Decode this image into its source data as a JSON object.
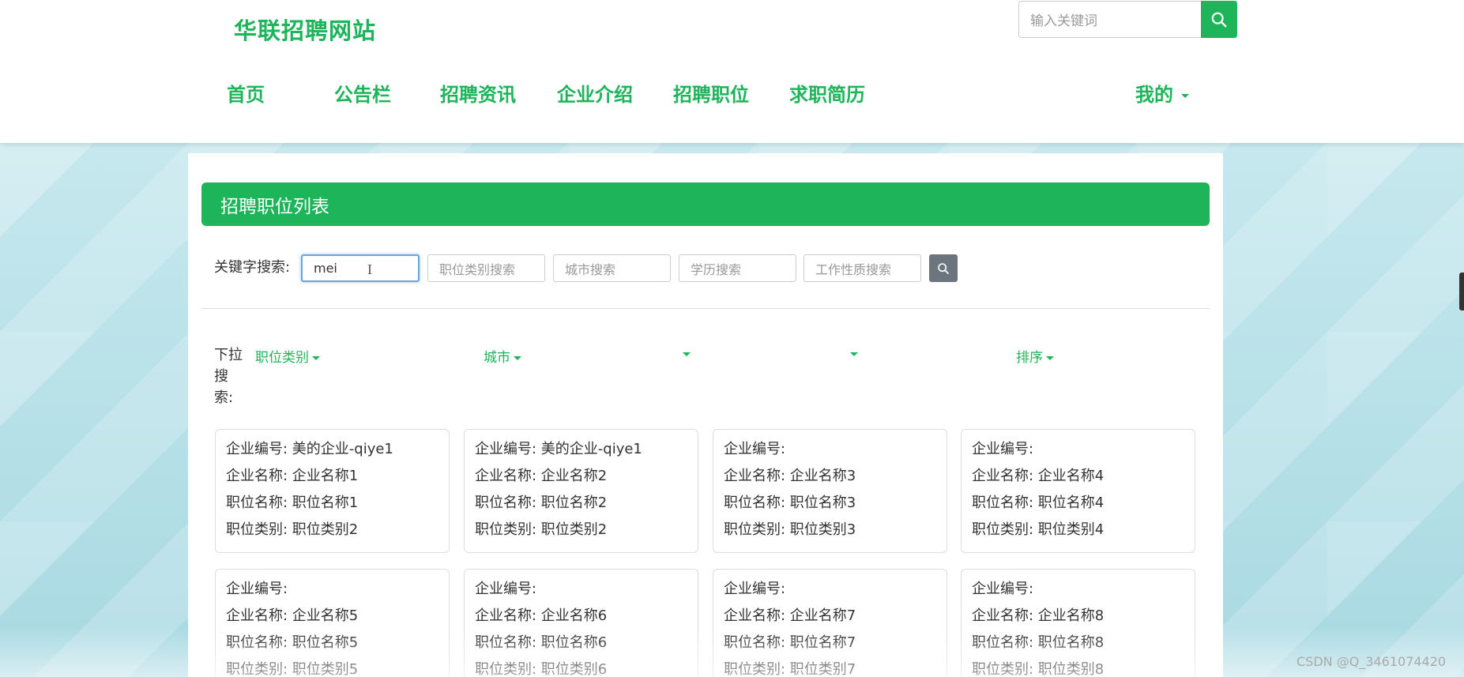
{
  "header": {
    "site_title": "华联招聘网站",
    "search_placeholder": "输入关键词",
    "nav": [
      {
        "label": "首页"
      },
      {
        "label": "公告栏"
      },
      {
        "label": "招聘资讯"
      },
      {
        "label": "企业介绍"
      },
      {
        "label": "招聘职位"
      },
      {
        "label": "求职简历"
      },
      {
        "label": "我的"
      }
    ]
  },
  "panel": {
    "title": "招聘职位列表",
    "keyword_label": "关键字搜索:",
    "keyword_value": "mei",
    "placeholders": {
      "category": "职位类别搜索",
      "city": "城市搜索",
      "education": "学历搜索",
      "job_type": "工作性质搜索"
    },
    "dropdown_label": "下拉搜索:",
    "dropdowns": [
      {
        "label": "职位类别"
      },
      {
        "label": "城市"
      },
      {
        "label": ""
      },
      {
        "label": ""
      },
      {
        "label": "排序"
      }
    ]
  },
  "cards": [
    {
      "company_no": "企业编号: 美的企业-qiye1",
      "company_name": "企业名称: 企业名称1",
      "job_name": "职位名称: 职位名称1",
      "job_category": "职位类别: 职位类别2"
    },
    {
      "company_no": "企业编号: 美的企业-qiye1",
      "company_name": "企业名称: 企业名称2",
      "job_name": "职位名称: 职位名称2",
      "job_category": "职位类别: 职位类别2"
    },
    {
      "company_no": "企业编号:",
      "company_name": "企业名称: 企业名称3",
      "job_name": "职位名称: 职位名称3",
      "job_category": "职位类别: 职位类别3"
    },
    {
      "company_no": "企业编号:",
      "company_name": "企业名称: 企业名称4",
      "job_name": "职位名称: 职位名称4",
      "job_category": "职位类别: 职位类别4"
    },
    {
      "company_no": "企业编号:",
      "company_name": "企业名称: 企业名称5",
      "job_name": "职位名称: 职位名称5",
      "job_category": "职位类别: 职位类别5"
    },
    {
      "company_no": "企业编号:",
      "company_name": "企业名称: 企业名称6",
      "job_name": "职位名称: 职位名称6",
      "job_category": "职位类别: 职位类别6"
    },
    {
      "company_no": "企业编号:",
      "company_name": "企业名称: 企业名称7",
      "job_name": "职位名称: 职位名称7",
      "job_category": "职位类别: 职位类别7"
    },
    {
      "company_no": "企业编号:",
      "company_name": "企业名称: 企业名称8",
      "job_name": "职位名称: 职位名称8",
      "job_category": "职位类别: 职位类别8"
    }
  ],
  "watermark": "CSDN @Q_3461074420",
  "colors": {
    "accent": "#1db45a",
    "filter_button": "#6c757d"
  }
}
